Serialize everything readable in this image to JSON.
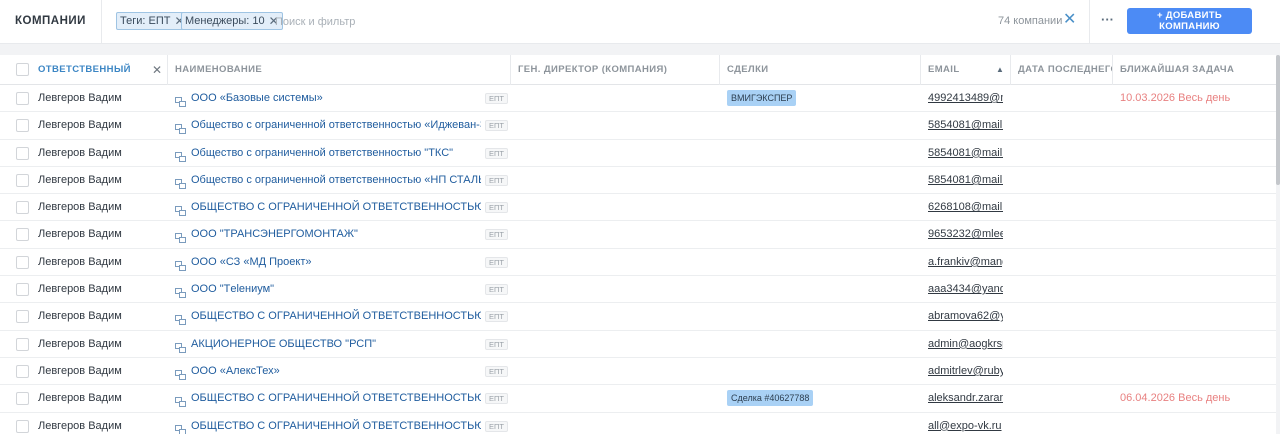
{
  "header": {
    "title": "КОМПАНИИ",
    "tags_chip": "Теги: ЕПТ",
    "managers_chip": "Менеджеры: 10",
    "search_placeholder": "Поиск и фильтр",
    "count": "74 компании",
    "add_button": "+ ДОБАВИТЬ КОМПАНИЮ"
  },
  "columns": {
    "responsible": "ОТВЕТСТВЕННЫЙ",
    "name": "НАИМЕНОВАНИЕ",
    "ceo": "ГЕН. ДИРЕКТОР (КОМПАНИЯ)",
    "deals": "СДЕЛКИ",
    "email": "EMAIL",
    "last_date": "ДАТА ПОСЛЕДНЕГО",
    "next_task": "БЛИЖАЙШАЯ ЗАДАЧА"
  },
  "rows": [
    {
      "responsible": "Левгеров Вадим",
      "name": "ООО «Базовые системы»",
      "tag": "ЕПТ",
      "deal": "ВМИГЭКСПЕР",
      "email": "4992413489@m",
      "task": "10.03.2026 Весь день"
    },
    {
      "responsible": "Левгеров Вадим",
      "name": "Общество с ограниченной ответственностью «Иджеван-Эко»",
      "tag": "ЕПТ",
      "deal": "",
      "email": "5854081@mail.r",
      "task": ""
    },
    {
      "responsible": "Левгеров Вадим",
      "name": "Общество с ограниченной ответственностью \"ТКС\"",
      "tag": "ЕПТ",
      "deal": "",
      "email": "5854081@mail.r",
      "task": ""
    },
    {
      "responsible": "Левгеров Вадим",
      "name": "Общество с ограниченной ответственностью «НП СТАЛЬ»",
      "tag": "ЕПТ",
      "deal": "",
      "email": "5854081@mail.r",
      "task": ""
    },
    {
      "responsible": "Левгеров Вадим",
      "name": "ОБЩЕСТВО С ОГРАНИЧЕННОЙ ОТВЕТСТВЕННОСТЬЮ \"БЕЛЭЛЕ",
      "tag": "ЕПТ",
      "deal": "",
      "email": "6268108@mail.r",
      "task": ""
    },
    {
      "responsible": "Левгеров Вадим",
      "name": "ООО \"ТРАНСЭНЕРГОМОНТАЖ\"",
      "tag": "ЕПТ",
      "deal": "",
      "email": "9653232@mleer",
      "task": ""
    },
    {
      "responsible": "Левгеров Вадим",
      "name": "ООО «СЗ «МД Проект»",
      "tag": "ЕПТ",
      "deal": "",
      "email": "a.frankiv@mang",
      "task": ""
    },
    {
      "responsible": "Левгеров Вадим",
      "name": "ООО \"Тelениум\"",
      "tag": "ЕПТ",
      "deal": "",
      "email": "aaa3434@yande",
      "task": ""
    },
    {
      "responsible": "Левгеров Вадим",
      "name": "ОБЩЕСТВО С ОГРАНИЧЕННОЙ ОТВЕТСТВЕННОСТЬЮ \"ЛЕВЕЛ\"",
      "tag": "ЕПТ",
      "deal": "",
      "email": "abramova62@ya",
      "task": ""
    },
    {
      "responsible": "Левгеров Вадим",
      "name": "АКЦИОНЕРНОЕ ОБЩЕСТВО \"РСП\"",
      "tag": "ЕПТ",
      "deal": "",
      "email": "admin@aogkrsp",
      "task": ""
    },
    {
      "responsible": "Левгеров Вадим",
      "name": "ООО «АлексТех»",
      "tag": "ЕПТ",
      "deal": "",
      "email": "admitrlev@ruby",
      "task": ""
    },
    {
      "responsible": "Левгеров Вадим",
      "name": "ОБЩЕСТВО С ОГРАНИЧЕННОЙ ОТВЕТСТВЕННОСТЬЮ \"Э+Х РУС",
      "tag": "ЕПТ",
      "deal": "Сделка #40627788",
      "email": "aleksandr.zaram",
      "task": "06.04.2026 Весь день"
    },
    {
      "responsible": "Левгеров Вадим",
      "name": "ОБЩЕСТВО С ОГРАНИЧЕННОЙ ОТВЕТСТВЕННОСТЬЮ \"ЭКСПО-",
      "tag": "ЕПТ",
      "deal": "",
      "email": "all@expo-vk.ru",
      "task": ""
    }
  ]
}
